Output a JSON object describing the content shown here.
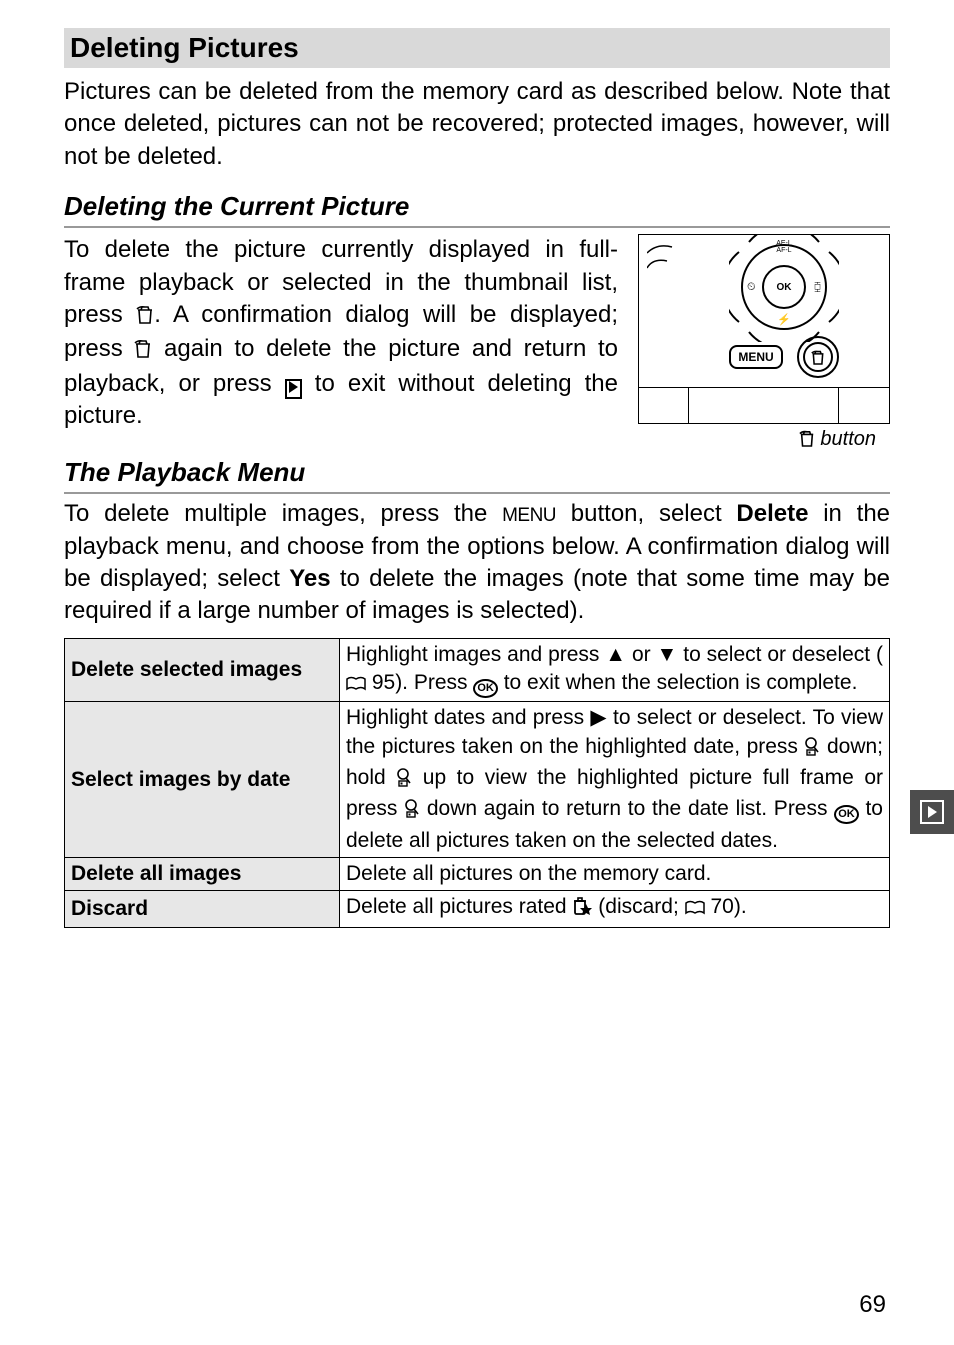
{
  "section": {
    "title": "Deleting Pictures",
    "intro": "Pictures can be deleted from the memory card as described below. Note that once deleted, pictures can not be recovered; protected images, however, will not be deleted."
  },
  "sub1": {
    "title": "Deleting the Current Picture",
    "body_parts": {
      "p1": "To delete the picture currently displayed in full-frame playback or selected in the thumbnail list, press ",
      "p2": ". A confirmation dialog will be displayed; press ",
      "p3": " again to delete the picture and return to playback, or press ",
      "p4": " to exit without deleting the picture."
    },
    "caption_suffix": " button"
  },
  "sub2": {
    "title": "The Playback Menu",
    "body_parts": {
      "p1": "To delete multiple images, press the ",
      "menu_word": "MENU",
      "p2": " button, select ",
      "bold1": "Delete",
      "p3": " in the playback menu, and choose from the options below. A confirmation dialog will be displayed; select ",
      "bold2": "Yes",
      "p4": " to delete the images (note that some time may be required if a large number of images is selected)."
    }
  },
  "table": {
    "rows": [
      {
        "label": "Delete selected images",
        "text_parts": {
          "a": "Highlight images and press ▲ or ▼ to select or deselect (",
          "ref1": " 95). Press ",
          "b": " to exit when the selection is complete."
        }
      },
      {
        "label": "Select images by date",
        "text_parts": {
          "a": "Highlight dates and press ▶ to select or deselect. To view the pictures taken on the highlighted date, press ",
          "b": " down; hold ",
          "c": " up to view the highlighted picture full frame or press ",
          "d": " down again to return to the date list. Press ",
          "e": " to delete all pictures taken on the selected dates."
        }
      },
      {
        "label": "Delete all images",
        "text": "Delete all pictures on the memory card."
      },
      {
        "label": "Discard",
        "text_parts": {
          "a": "Delete all pictures rated ",
          "b": " (discard; ",
          "c": " 70)."
        }
      }
    ]
  },
  "dpad": {
    "ok": "OK",
    "ae_l": "AE-L",
    "af_l": "AF-L",
    "menu": "MENU"
  },
  "page_number": "69"
}
